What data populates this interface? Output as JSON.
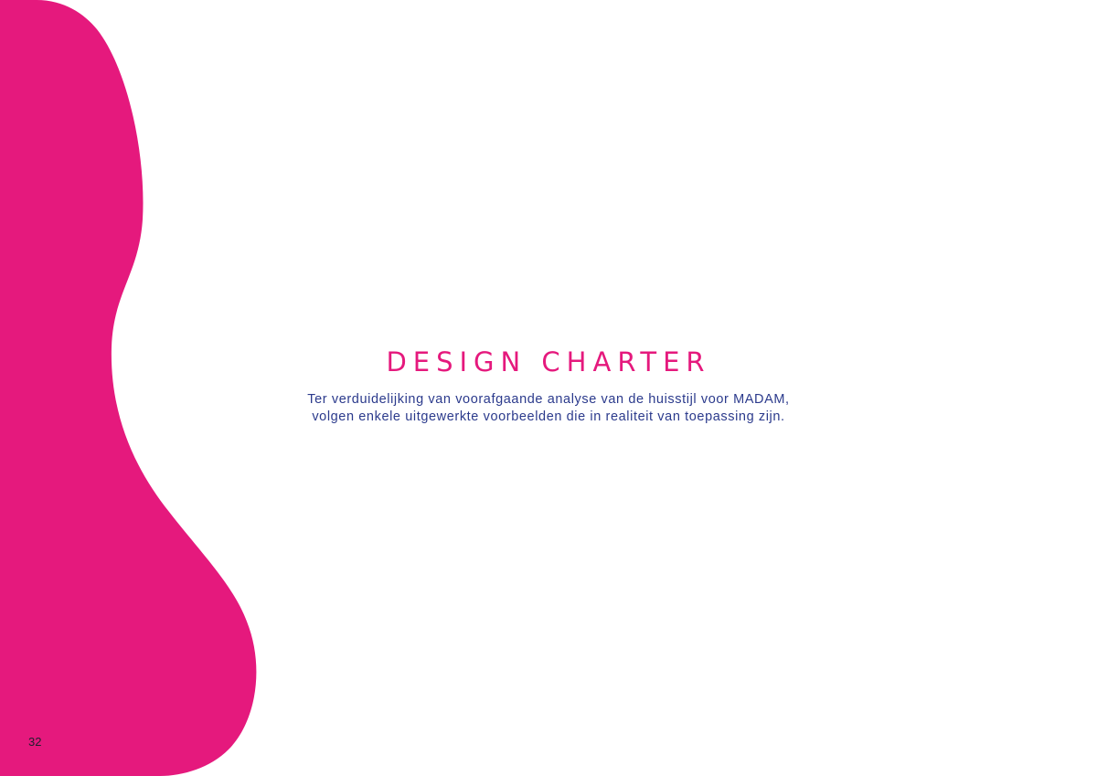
{
  "colors": {
    "accent": "#E5197D",
    "text": "#2B3A8C",
    "page_number": "#1f1f2e",
    "background": "#FFFFFF"
  },
  "document": {
    "title": "DESIGN CHARTER",
    "subtitle_lines": [
      "Ter verduidelijking van voorafgaande analyse van de huisstijl voor MADAM,",
      "volgen enkele uitgewerkte voorbeelden die in realiteit van toepassing zijn."
    ],
    "page_number": "32"
  }
}
